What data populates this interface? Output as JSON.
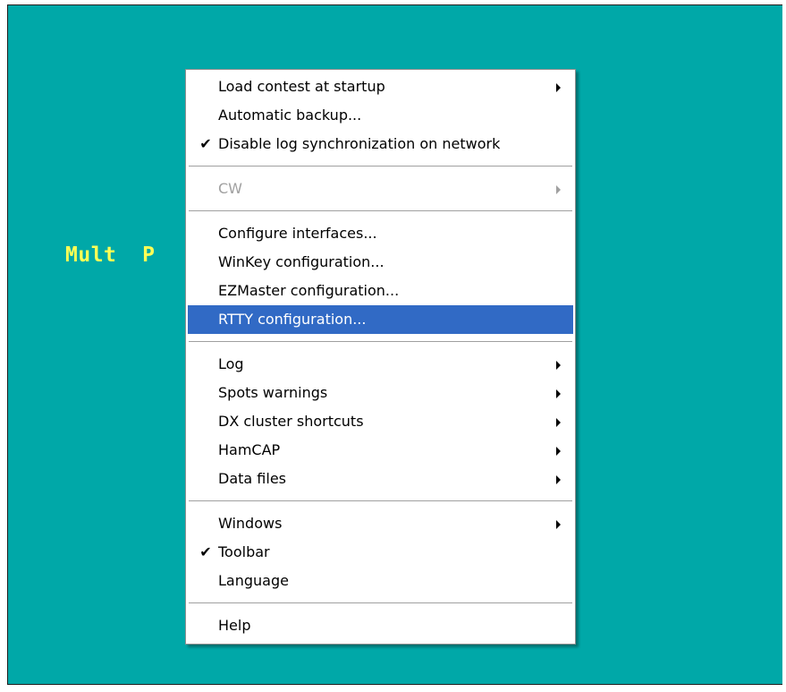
{
  "background": {
    "label": "Mult  P",
    "color": "#00a8a8",
    "text_color": "#ffff55"
  },
  "menu": {
    "highlight_color": "#316ac5",
    "groups": [
      [
        {
          "label": "Load contest at startup",
          "checked": false,
          "submenu": true,
          "disabled": false
        },
        {
          "label": "Automatic backup...",
          "checked": false,
          "submenu": false,
          "disabled": false
        },
        {
          "label": "Disable log synchronization on network",
          "checked": true,
          "submenu": false,
          "disabled": false
        }
      ],
      [
        {
          "label": "CW",
          "checked": false,
          "submenu": true,
          "disabled": true
        }
      ],
      [
        {
          "label": "Configure interfaces...",
          "checked": false,
          "submenu": false,
          "disabled": false
        },
        {
          "label": "WinKey configuration...",
          "checked": false,
          "submenu": false,
          "disabled": false
        },
        {
          "label": "EZMaster configuration...",
          "checked": false,
          "submenu": false,
          "disabled": false
        },
        {
          "label": "RTTY configuration...",
          "checked": false,
          "submenu": false,
          "disabled": false,
          "highlighted": true
        }
      ],
      [
        {
          "label": "Log",
          "checked": false,
          "submenu": true,
          "disabled": false
        },
        {
          "label": "Spots warnings",
          "checked": false,
          "submenu": true,
          "disabled": false
        },
        {
          "label": "DX cluster shortcuts",
          "checked": false,
          "submenu": true,
          "disabled": false
        },
        {
          "label": "HamCAP",
          "checked": false,
          "submenu": true,
          "disabled": false
        },
        {
          "label": "Data files",
          "checked": false,
          "submenu": true,
          "disabled": false
        }
      ],
      [
        {
          "label": "Windows",
          "checked": false,
          "submenu": true,
          "disabled": false
        },
        {
          "label": "Toolbar",
          "checked": true,
          "submenu": false,
          "disabled": false
        },
        {
          "label": "Language",
          "checked": false,
          "submenu": false,
          "disabled": false
        }
      ],
      [
        {
          "label": "Help",
          "checked": false,
          "submenu": false,
          "disabled": false
        }
      ]
    ]
  }
}
